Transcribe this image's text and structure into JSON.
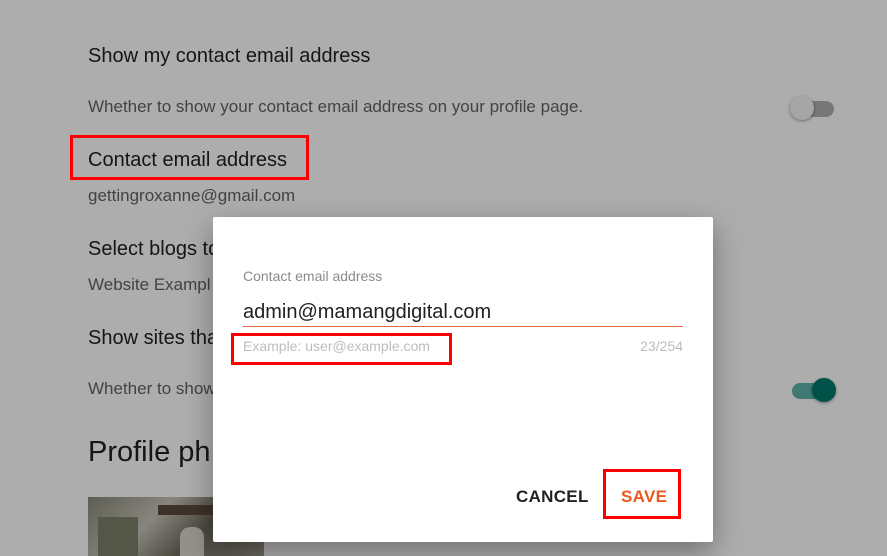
{
  "settings": {
    "show_contact": {
      "title": "Show my contact email address",
      "description": "Whether to show your contact email address on your profile page.",
      "toggle_state": "off"
    },
    "contact_email": {
      "title": "Contact email address",
      "value": "gettingroxanne@gmail.com"
    },
    "select_blogs": {
      "title": "Select blogs to",
      "value": "Website Exampl"
    },
    "show_sites": {
      "title": "Show sites tha",
      "description": "Whether to show",
      "toggle_state": "on"
    },
    "profile_photo": {
      "heading": "Profile ph"
    }
  },
  "dialog": {
    "field_label": "Contact email address",
    "input_value": "admin@mamangdigital.com",
    "hint": "Example: user@example.com",
    "char_count": "23/254",
    "cancel_label": "CANCEL",
    "save_label": "SAVE"
  },
  "colors": {
    "accent": "#e8581f",
    "toggle_on": "#00796b",
    "highlight": "#ff0000"
  }
}
